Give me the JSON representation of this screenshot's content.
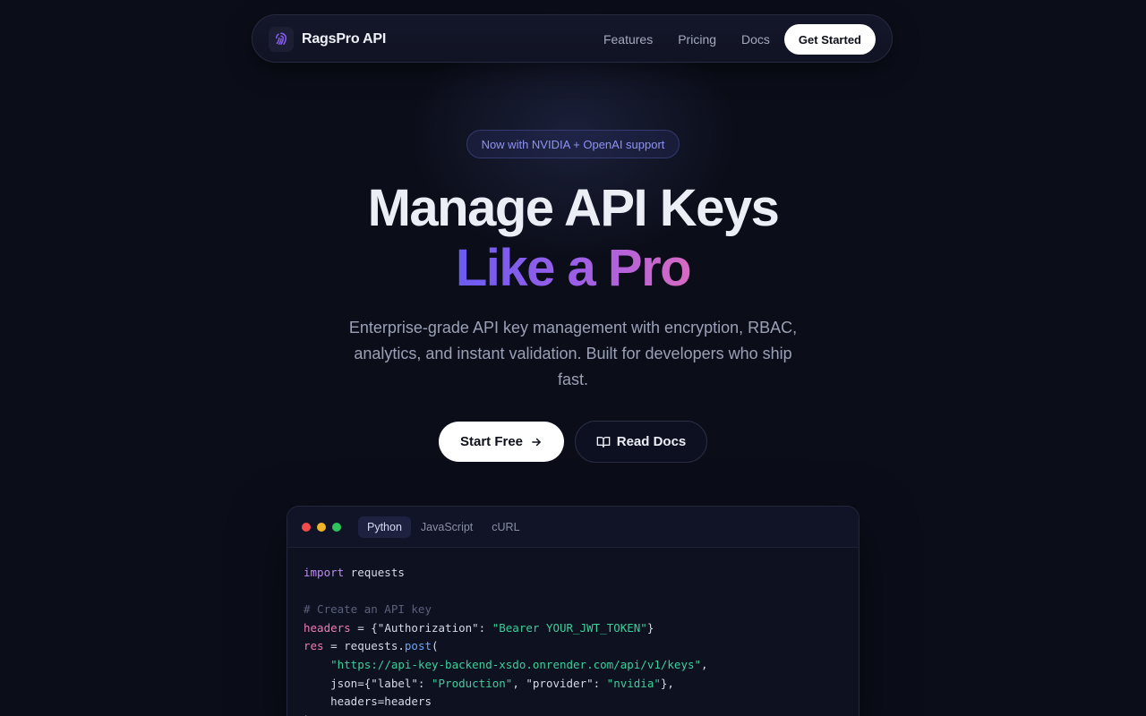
{
  "nav": {
    "brand": "RagsPro API",
    "links": [
      "Features",
      "Pricing",
      "Docs"
    ],
    "cta": "Get Started"
  },
  "badge": "Now with NVIDIA + OpenAI support",
  "hero": {
    "title_line1": "Manage API Keys",
    "title_line2": "Like a Pro",
    "subtitle": "Enterprise-grade API key management with encryption, RBAC, analytics, and instant validation. Built for developers who ship fast."
  },
  "buttons": {
    "primary": "Start Free",
    "secondary": "Read Docs"
  },
  "code": {
    "tabs": [
      "Python",
      "JavaScript",
      "cURL"
    ],
    "active_tab": "Python",
    "lines": {
      "l1_kw": "import",
      "l1_rest": " requests",
      "comment": "# Create an API key",
      "l3_var": "headers",
      "l3_a": " = {\"Authorization\": ",
      "l3_str": "\"Bearer YOUR_JWT_TOKEN\"",
      "l3_b": "}",
      "l4_var": "res",
      "l4_a": " = requests.",
      "l4_fn": "post",
      "l4_b": "(",
      "l5_str": "\"https://api-key-backend-xsdo.onrender.com/api/v1/keys\"",
      "l5_b": ",",
      "l6_a": "    json={\"label\": ",
      "l6_str1": "\"Production\"",
      "l6_b": ", \"provider\": ",
      "l6_str2": "\"nvidia\"",
      "l6_c": "},",
      "l7": "    headers=headers",
      "l8": ")"
    }
  },
  "colors": {
    "background": "#0b0e19",
    "accent_start": "#6a5cf0",
    "accent_end": "#d86ac2",
    "badge_text": "#8d93f0",
    "window_dot_red": "#ef4b4b",
    "window_dot_yellow": "#f0b429",
    "window_dot_green": "#2ec45c"
  },
  "icons": {
    "logo": "fingerprint-icon",
    "primary_button": "arrow-right-icon",
    "secondary_button": "book-open-icon"
  }
}
